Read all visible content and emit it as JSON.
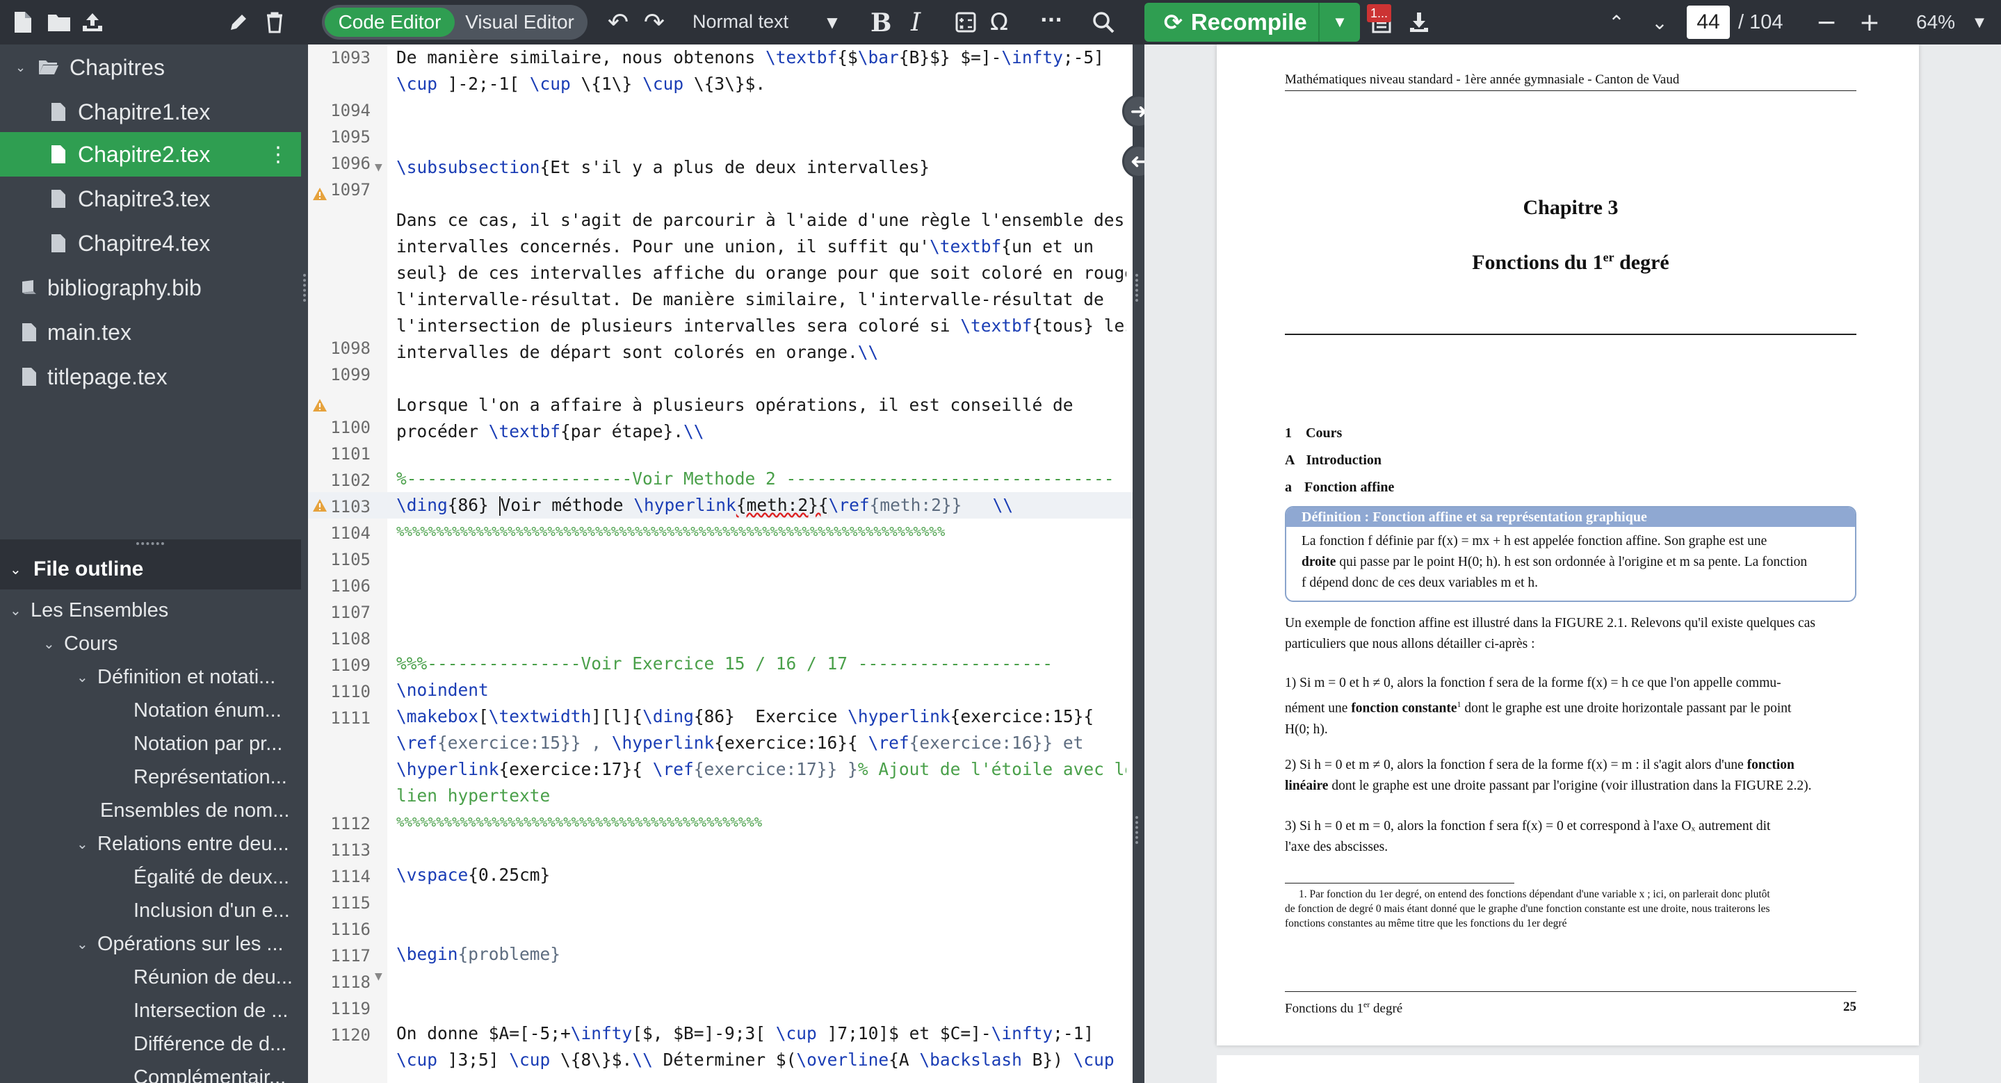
{
  "toolbar": {
    "code_editor_label": "Code Editor",
    "visual_editor_label": "Visual Editor",
    "style_select": "Normal text",
    "bold_label": "B",
    "italic_label": "I",
    "omega_label": "Ω",
    "more_label": "···",
    "recompile_label": "Recompile",
    "badge_label": "1...",
    "current_page": "44",
    "total_pages": "/ 104",
    "zoom": "64%"
  },
  "file_tree": {
    "folder": "Chapitres",
    "files": [
      "Chapitre1.tex",
      "Chapitre2.tex",
      "Chapitre3.tex",
      "Chapitre4.tex"
    ],
    "root_files": [
      "bibliography.bib",
      "main.tex",
      "titlepage.tex"
    ]
  },
  "outline": {
    "title": "File outline",
    "items": [
      "Les Ensembles",
      "Cours",
      "Définition et notati...",
      "Notation énum...",
      "Notation par pr...",
      "Représentation...",
      "Ensembles de nom...",
      "Relations entre deu...",
      "Égalité de deux...",
      "Inclusion d'un e...",
      "Opérations sur les ...",
      "Réunion de deu...",
      "Intersection de ...",
      "Différence de d...",
      "Complémentair..."
    ]
  },
  "editor": {
    "line_numbers": [
      "1093",
      "",
      "1094",
      "1095",
      "1096",
      "1097",
      "",
      "",
      "",
      "",
      "",
      "1098",
      "1099",
      "",
      "1100",
      "1101",
      "1102",
      "1103",
      "1104",
      "1105",
      "1106",
      "1107",
      "1108",
      "1109",
      "1110",
      "1111",
      "",
      "",
      "",
      "1112",
      "1113",
      "1114",
      "1115",
      "1116",
      "1117",
      "1118",
      "1119",
      "1120",
      "",
      ""
    ],
    "lines": {
      "l1093a": "De manière similaire, nous obtenons ",
      "l1093b": "{$",
      "l1093c": "{B}$} $=]-",
      "l1093d": ";-5]",
      "l1093e": " ]-2;-1[ ",
      "l1093f": " \\{1\\} ",
      "l1093g": " \\{3\\}$.",
      "l1095": "{Et s'il y a plus de deux intervalles}",
      "l1097a": "Dans ce cas, il s'agit de parcourir à l'aide d'une règle l'ensemble des",
      "l1097b": "intervalles concernés. Pour une union, il suffit qu'",
      "l1097b2": "{un et un",
      "l1097c": "seul} de ces intervalles affiche du orange pour que soit coloré en rouge",
      "l1097d": "l'intervalle-résultat. De manière similaire, l'intervalle-résultat de",
      "l1097e": "l'intersection de plusieurs intervalles sera coloré si ",
      "l1097e2": "{tous} les",
      "l1097f": "intervalles de départ sont colorés en orange.",
      "l1099a": "Lorsque l'on a affaire à plusieurs opérations, il est conseillé de",
      "l1099b": "procéder ",
      "l1099b2": "{par étape}.",
      "l1102": "%----------------------Voir Methode 2 --------------------------------",
      "l1103a": "{86} ",
      "l1103b": "Voir méthode ",
      "l1103c": "{meth:2}{",
      "l1103d": "{meth:2}}   ",
      "l1104": "%%%%%%%%%%%%%%%%%%%%%%%%%%%%%%%%%%%%%%%%%%%%%%%%%%%%%%%%%%%%%%%%%%%%%",
      "l1109": "%%%---------------Voir Exercice 15 / 16 / 17 -------------------",
      "l1110": "\\noindent",
      "l1111a": "[",
      "l1111b": "][l]{",
      "l1111c": "{86}  Exercice ",
      "l1111d": "{exercice:15}{",
      "l1111e": "{exercice:15}} , ",
      "l1111f": "{exercice:16}{ ",
      "l1111g": "{exercice:16}} et",
      "l1111h": "{exercice:17}{ ",
      "l1111i": "{exercice:17}} }",
      "l1111j": "% Ajout de l'étoile avec le",
      "l1111k": "lien hypertexte",
      "l1112": "%%%%%%%%%%%%%%%%%%%%%%%%%%%%%%%%%%%%%%%%%%%%%%",
      "l1114": "{0.25cm}",
      "l1117": "{probleme}",
      "l1120a": "On donne $A=[-5;+",
      "l1120b": "[$, $B=]-9;3[ ",
      "l1120c": " ]7;10]$ et $C=]-",
      "l1120d": ";-1]",
      "l1120e": " ]3;5] ",
      "l1120f": " \\{8\\}$.",
      "l1120g": " Déterminer $(",
      "l1120h": "{A ",
      "l1120i": " B}) ",
      "kw_textbf": "\\textbf",
      "kw_bar": "\\bar",
      "kw_infty": "\\infty",
      "kw_cup": "\\cup",
      "kw_subsub": "\\subsubsection",
      "kw_dbl": "\\\\",
      "kw_ding": "\\ding",
      "kw_hyperlink": "\\hyperlink",
      "kw_ref": "\\ref",
      "kw_makebox": "\\makebox",
      "kw_textwidth": "\\textwidth",
      "kw_vspace": "\\vspace",
      "kw_begin": "\\begin",
      "kw_overline": "\\overline",
      "kw_backslash": "\\backslash",
      "kw_cup2": "\\cup"
    }
  },
  "pdf": {
    "header": "Mathématiques niveau standard - 1ère année gymnasiale - Canton de Vaud",
    "chapter": "Chapitre 3",
    "chapter_title": "Fonctions du 1",
    "chapter_title_sup": "er",
    "chapter_title_end": " degré",
    "s1_num": "1",
    "s1": "Cours",
    "sA_num": "A",
    "sA": "Introduction",
    "sa_num": "a",
    "sa": "Fonction affine",
    "def_title": "Définition : Fonction affine et sa représentation graphique",
    "def_l1": "La fonction f définie par f(x) = mx + h est appelée fonction affine. Son graphe est une",
    "def_l2a": "droite",
    "def_l2b": " qui passe par le point H(0; h). h est son ordonnée à l'origine et m sa pente. La fonction",
    "def_l3": "f dépend donc de ces deux variables m et h.",
    "p1_l1": "Un exemple de fonction affine est illustré dans la FIGURE 2.1. Relevons qu'il existe quelques cas",
    "p1_l2": "particuliers que nous allons détailler ci-après :",
    "p2_l1": "1) Si m = 0 et h ≠ 0, alors la fonction f sera de la forme f(x) = h ce que l'on appelle commu-",
    "p2_l2a": "nément une ",
    "p2_l2b": "fonction constante",
    "p2_l2c": " dont le graphe est une droite horizontale passant par le point",
    "p2_l3": "H(0; h).",
    "p3_l1a": "2) Si h = 0 et m ≠ 0, alors la fonction f sera de la forme f(x) = m : il s'agit alors d'une ",
    "p3_l1b": "fonction",
    "p3_l2a": "linéaire",
    "p3_l2b": " dont le graphe est une droite passant par l'origine (voir illustration dans la FIGURE 2.2).",
    "p4_l1": "3) Si h = 0 et m = 0, alors la fonction f sera f(x) = 0 et correspond à l'axe Oₓ autrement dit",
    "p4_l2": "l'axe des abscisses.",
    "fn_l1": "1. Par fonction du 1er degré, on entend des fonctions dépendant d'une variable x ; ici, on parlerait donc plutôt",
    "fn_l2": "de fonction de degré 0 mais étant donné que le graphe d'une fonction constante est une droite, nous traiterons les",
    "fn_l3": "fonctions constantes au même titre que les fonctions du 1er degré",
    "footer_left": "Fonctions du 1",
    "footer_sup": "er",
    "footer_end": " degré",
    "footer_page": "25"
  }
}
